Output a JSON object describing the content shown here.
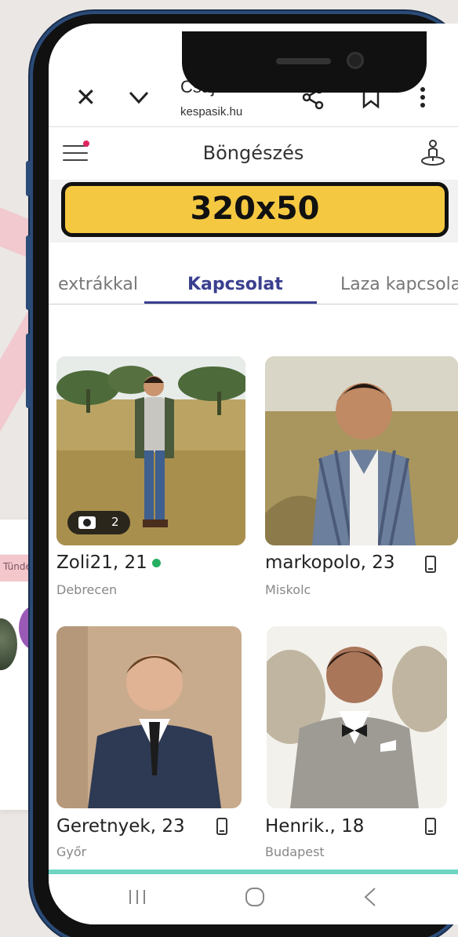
{
  "browser": {
    "title": "Csajok és...",
    "url": "kespasik.hu",
    "close_icon": "close-icon",
    "collapse_icon": "chevron-down-icon",
    "share_icon": "share-icon",
    "bookmark_icon": "bookmark-icon",
    "menu_icon": "more-vert-icon"
  },
  "background": {
    "pink_bar_label": "Tünde"
  },
  "app": {
    "title": "Böngészés",
    "menu_icon": "hamburger-icon",
    "location_icon": "location-person-icon"
  },
  "ad": {
    "label": "320x50",
    "color": "#f5c842"
  },
  "tabs": [
    {
      "label": "extrákkal",
      "active": false
    },
    {
      "label": "Kapcsolat",
      "active": true
    },
    {
      "label": "Laza kapcsolat",
      "active": false
    }
  ],
  "profiles": [
    {
      "name": "Zoli21, 21",
      "city": "Debrecen",
      "online": true,
      "photo_count": "2"
    },
    {
      "name": "markopolo, 23",
      "city": "Miskolc",
      "mobile": true
    },
    {
      "name": "Geretnyek, 23",
      "city": "Győr",
      "mobile": true
    },
    {
      "name": "Henrik., 18",
      "city": "Budapest",
      "mobile": true
    }
  ],
  "nav": {
    "recent_icon": "recent-apps-icon",
    "home_icon": "home-icon",
    "back_icon": "back-icon"
  },
  "colors": {
    "accent": "#3a3f8f",
    "online": "#27ae60",
    "teal": "#6fd6c4",
    "phone_frame": "#2b4b78"
  }
}
